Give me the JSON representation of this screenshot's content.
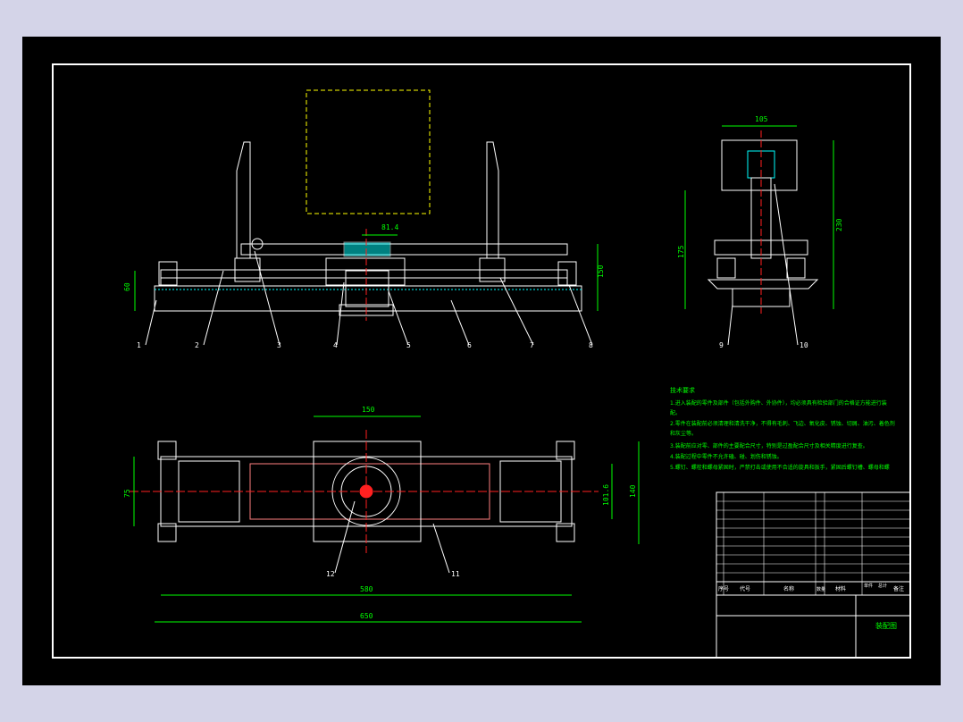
{
  "colors": {
    "background": "#d4d4e8",
    "sheet": "#000000",
    "line": "#ffffff",
    "dimension": "#00ff00",
    "centerline": "#ff2020",
    "hidden": "#ffff00",
    "hatch": "#00ffff"
  },
  "front_view": {
    "dims": {
      "overall_height": "150",
      "left_height": "60",
      "top_width": "81.4"
    },
    "balloons": [
      "1",
      "2",
      "3",
      "4",
      "5",
      "6",
      "7",
      "8"
    ]
  },
  "side_view": {
    "dims": {
      "top_width": "105",
      "total_height": "230",
      "left_height": "175"
    },
    "balloons": [
      "9",
      "10"
    ]
  },
  "top_view": {
    "dims": {
      "top_width": "150",
      "left_height": "75",
      "right_inner": "101.6",
      "right_outer": "140",
      "inner_length": "580",
      "overall_length": "650"
    },
    "balloons": [
      "12",
      "11"
    ]
  },
  "notes": {
    "title": "技术要求",
    "lines": [
      "1.进入装配的零件及部件（包括外购件、外协件），均必须具有检验部门的合格证方能进行装",
      "配。",
      "2.零件在装配前必须清理和清洗干净，不得有毛刺、飞边、氧化皮、锈蚀、切屑、油污、着色剂",
      "和灰尘等。",
      "3.装配前应对零、部件的主要配合尺寸，特别是过盈配合尺寸及相关精度进行复查。",
      "4.装配过程中零件不允许磕、碰、划伤和锈蚀。",
      "5.螺钉、螺栓和螺母紧固时，严禁打击或使用不合适的旋具和扳手，紧固后螺钉槽、螺母和螺"
    ]
  },
  "title_block": {
    "bom_header": [
      "序号",
      "代号",
      "名称",
      "数量",
      "材料",
      "单件",
      "总计",
      "备注"
    ],
    "drawing_name": "装配图"
  }
}
